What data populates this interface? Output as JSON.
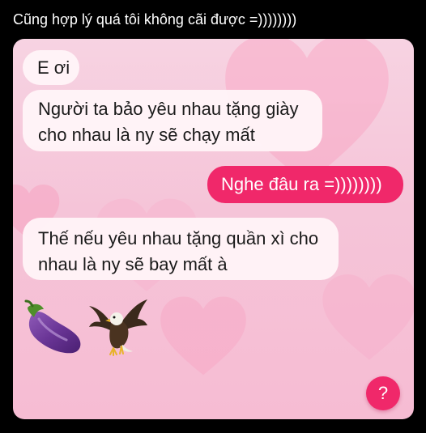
{
  "post": {
    "caption": "Cũng hợp lý quá tôi không cãi được =))))))))"
  },
  "chat": {
    "theme_colors": {
      "background": "#f6c9dc",
      "incoming_bubble": "#fff4f8",
      "outgoing_bubble": "#f0286a"
    },
    "messages": [
      {
        "direction": "incoming",
        "lines": [
          "E ơi"
        ]
      },
      {
        "direction": "incoming",
        "lines": [
          "Người ta bảo yêu nhau tặng giày",
          "cho nhau là ny sẽ chạy mất"
        ]
      },
      {
        "direction": "outgoing",
        "lines": [
          "Nghe đâu ra =))))))))"
        ]
      },
      {
        "direction": "incoming",
        "lines": [
          "Thế nếu yêu nhau tặng quần xì cho",
          "nhau là ny sẽ bay mất à"
        ]
      }
    ],
    "sticker_icons": [
      "eggplant-icon",
      "eagle-icon"
    ],
    "help_button_label": "?"
  }
}
